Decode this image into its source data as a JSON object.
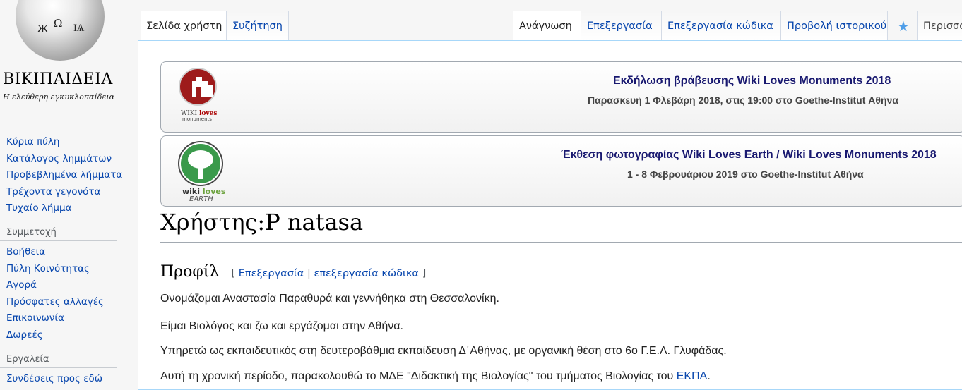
{
  "logo": {
    "wordmark": "ΒΙΚΙΠΑΙΔΕΙΑ",
    "tagline": "Η ελεύθερη εγκυκλοπαίδεια",
    "glyphs": [
      "Ω",
      "Ж",
      "Ѩ"
    ]
  },
  "sidebar": {
    "nav": [
      "Κύρια πύλη",
      "Κατάλογος λημμάτων",
      "Προβεβλημένα λήμματα",
      "Τρέχοντα γεγονότα",
      "Τυχαίο λήμμα"
    ],
    "participation_heading": "Συμμετοχή",
    "participation": [
      "Βοήθεια",
      "Πύλη Κοινότητας",
      "Αγορά",
      "Πρόσφατες αλλαγές",
      "Επικοινωνία",
      "Δωρεές"
    ],
    "tools_heading": "Εργαλεία",
    "tools": [
      "Συνδέσεις προς εδώ"
    ]
  },
  "tabs": {
    "user_page": "Σελίδα χρήστη",
    "discussion": "Συζήτηση",
    "read": "Ανάγνωση",
    "edit": "Επεξεργασία",
    "edit_source": "Επεξεργασία κώδικα",
    "history": "Προβολή ιστορικού",
    "more": "Περισσότερα"
  },
  "banners": [
    {
      "title": "Εκδήλωση βράβευσης Wiki Loves Monuments 2018",
      "subtitle": "Παρασκευή 1 Φλεβάρη 2018, στις 19:00 στο Goethe-Institut Αθήνα",
      "logo_word1": "WIKI",
      "logo_word2": "loves",
      "logo_word3": "monuments"
    },
    {
      "title": "Έκθεση φωτογραφίας Wiki Loves Earth / Wiki Loves Monuments 2018",
      "subtitle": "1 - 8 Φεβρουάριου 2019 στο Goethe-Institut Αθήνα",
      "logo_word1": "wiki",
      "logo_word2": "loves",
      "logo_word3": "EARTH"
    }
  ],
  "page": {
    "title": "Χρήστης:P natasa",
    "section_heading": "Προφίλ",
    "edit_open": "[",
    "edit_link": "Επεξεργασία",
    "edit_sep": "|",
    "edit_source_link": "επεξεργασία κώδικα",
    "edit_close": "]",
    "paragraphs": [
      "Ονομάζομαι Αναστασία Παραθυρά και γεννήθηκα στη Θεσσαλονίκη.",
      "Είμαι Βιολόγος και ζω και εργάζομαι στην Αθήνα.",
      "Υπηρετώ ως εκπαιδευτικός στη δευτεροβάθμια εκπαίδευση Δ΄Αθήνας, με οργανική θέση στο 6ο Γ.Ε.Λ. Γλυφάδας."
    ],
    "para4_text": "Αυτή τη χρονική περίοδο, παρακολουθώ το ΜΔΕ \"Διδακτική της Βιολογίας\" του τμήματος Βιολογίας του ",
    "para4_link": "ΕΚΠΑ",
    "para4_end": "."
  },
  "colors": {
    "link": "#0645ad",
    "banner_title": "#191970",
    "content_border": "#a7d7f9",
    "star": "#4f9ee8"
  }
}
